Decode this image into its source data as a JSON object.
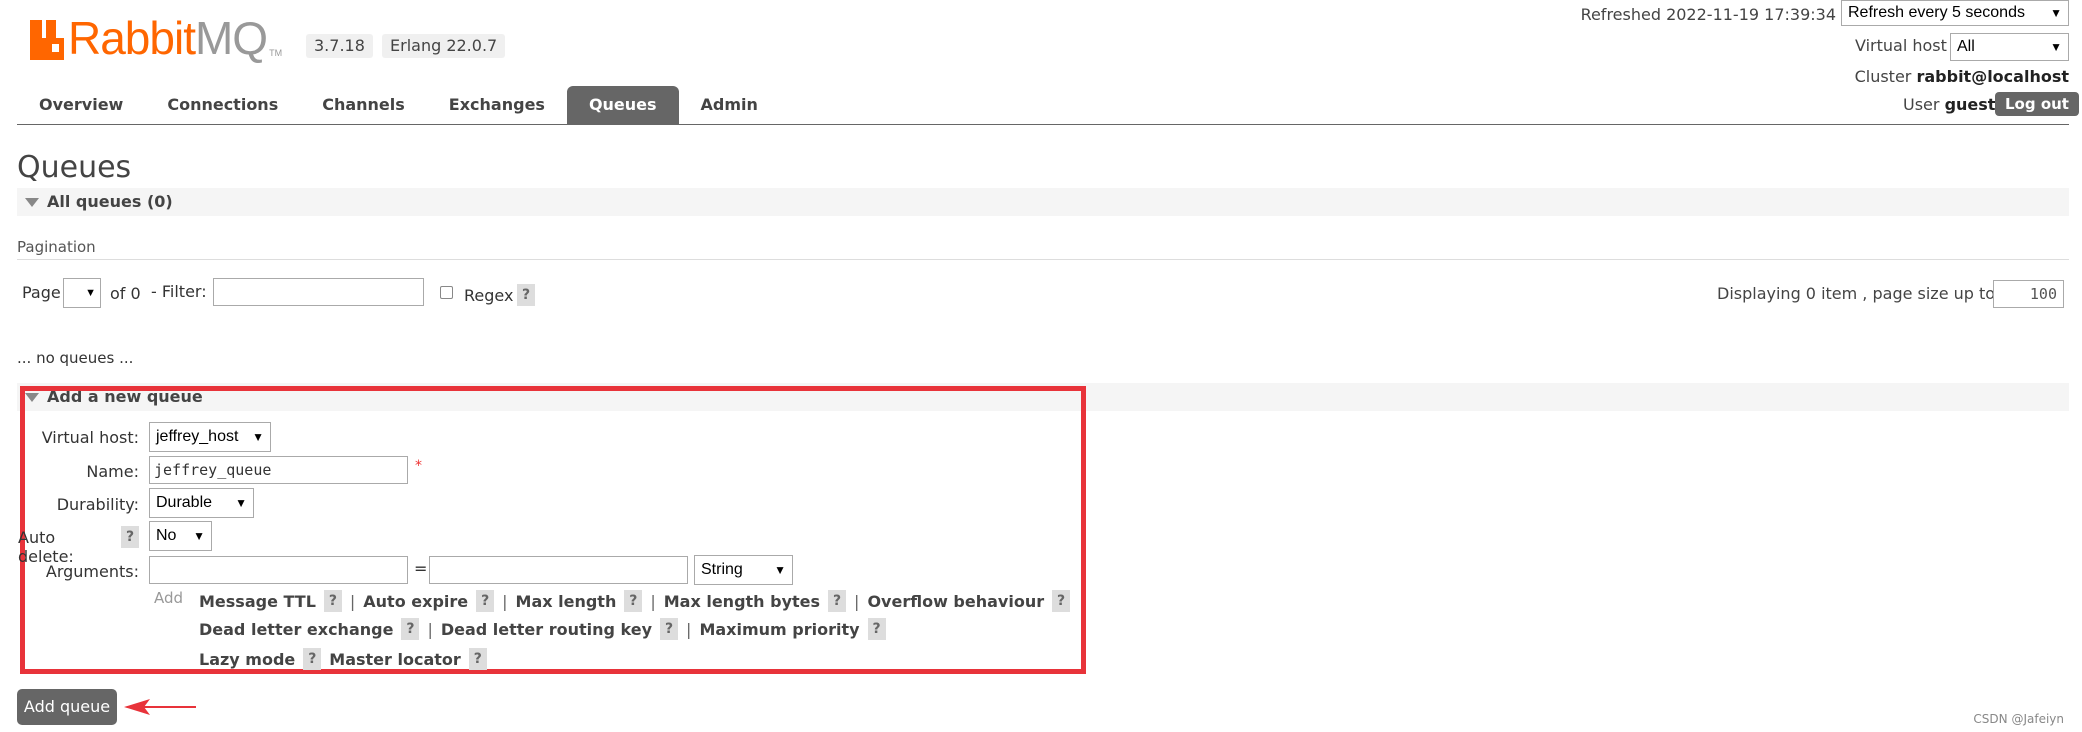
{
  "brand": {
    "name_main": "Rabbit",
    "name_suffix": "MQ",
    "trademark": "TM"
  },
  "header": {
    "version": "3.7.18",
    "erlang": "Erlang 22.0.7",
    "refreshed": "Refreshed 2022-11-19 17:39:34",
    "refresh_select": "Refresh every 5 seconds",
    "vhost_label": "Virtual host",
    "vhost_value": "All",
    "cluster_label": "Cluster",
    "cluster_value": "rabbit@localhost",
    "user_label": "User",
    "user_value": "guest",
    "logout": "Log out"
  },
  "tabs": [
    {
      "label": "Overview",
      "active": false
    },
    {
      "label": "Connections",
      "active": false
    },
    {
      "label": "Channels",
      "active": false
    },
    {
      "label": "Exchanges",
      "active": false
    },
    {
      "label": "Queues",
      "active": true
    },
    {
      "label": "Admin",
      "active": false
    }
  ],
  "page": {
    "title": "Queues",
    "all_queues": "All queues (0)",
    "pagination_label": "Pagination",
    "page_label": "Page",
    "page_value": "",
    "of_text": "of 0",
    "filter_label": "- Filter:",
    "filter_value": "",
    "regex_label": "Regex",
    "help": "?",
    "displaying": "Displaying 0 item , page size up to:",
    "page_size": "100",
    "no_queues": "... no queues ..."
  },
  "add_queue": {
    "section_title": "Add a new queue",
    "vhost_label": "Virtual host:",
    "vhost_value": "jeffrey_host",
    "name_label": "Name:",
    "name_value": "jeffrey_queue",
    "required_mark": "*",
    "durability_label": "Durability:",
    "durability_value": "Durable",
    "autodelete_label": "Auto delete:",
    "autodelete_value": "No",
    "arguments_label": "Arguments:",
    "equals": "=",
    "arg_type": "String",
    "add_link": "Add",
    "arg_keys_row1": [
      "Message TTL",
      "Auto expire",
      "Max length",
      "Max length bytes",
      "Overflow behaviour"
    ],
    "arg_keys_row2": [
      "Dead letter exchange",
      "Dead letter routing key",
      "Maximum priority"
    ],
    "arg_keys_row3": [
      "Lazy mode",
      "Master locator"
    ],
    "separator": "|",
    "submit": "Add queue"
  },
  "watermark": "CSDN @Jafeiyn",
  "colors": {
    "accent": "#ff6600",
    "tab_active": "#666666",
    "highlight": "#e8333a"
  }
}
